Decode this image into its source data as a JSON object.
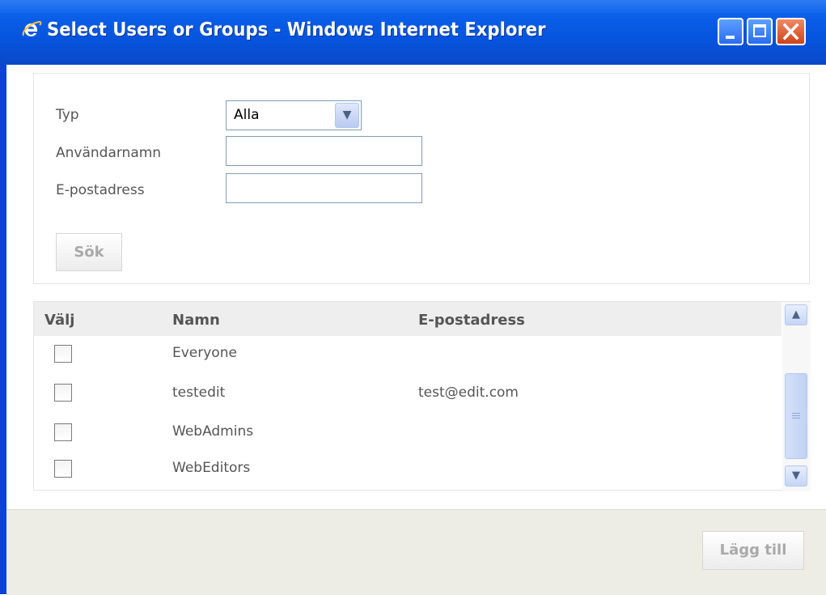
{
  "window": {
    "title": "Select Users or Groups - Windows Internet Explorer",
    "icon": "internet-explorer-icon",
    "controls": [
      "minimize-icon",
      "maximize-icon",
      "close-icon"
    ]
  },
  "search": {
    "type_label": "Typ",
    "type_value": "Alla",
    "username_label": "Användarnamn",
    "username_value": "",
    "email_label": "E-postadress",
    "email_value": "",
    "search_button": "Sök"
  },
  "results": {
    "columns": [
      "Välj",
      "Namn",
      "E-postadress"
    ],
    "rows": [
      {
        "checked": false,
        "name": "Everyone",
        "email": ""
      },
      {
        "checked": false,
        "name": "testedit",
        "email": "test@edit.com"
      },
      {
        "checked": false,
        "name": "WebAdmins",
        "email": ""
      },
      {
        "checked": false,
        "name": "WebEditors",
        "email": ""
      }
    ]
  },
  "footer": {
    "add_button": "Lägg till"
  },
  "colors": {
    "titlebar": "#0654de",
    "frame": "#0a43d6",
    "header_bg": "#eeeeee",
    "footer_bg": "#eeede5",
    "disabled_text": "#a9a9a9"
  }
}
